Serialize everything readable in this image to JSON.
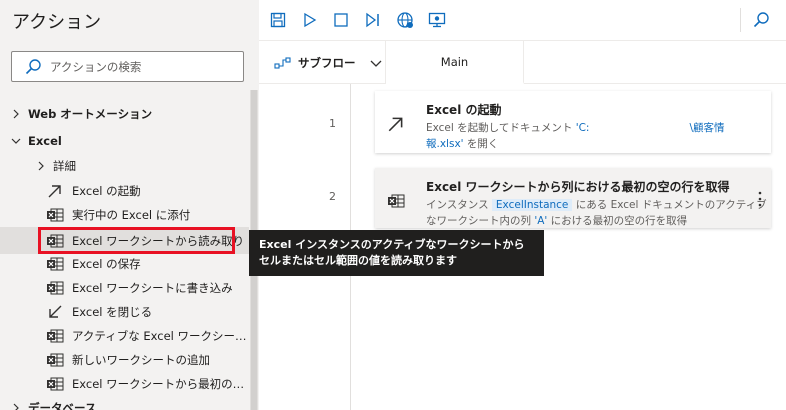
{
  "left_panel": {
    "title": "アクション",
    "search_placeholder": "アクションの検索",
    "groups": [
      {
        "label": "Web オートメーション"
      },
      {
        "label": "Excel"
      },
      {
        "label": "データベース"
      }
    ],
    "excel_subgroup": "詳細",
    "excel_items": [
      {
        "label": "Excel の起動",
        "icon": "arrow-launch-icon"
      },
      {
        "label": "実行中の Excel に添付",
        "icon": "excel-sheet-icon"
      },
      {
        "label": "Excel ワークシートから読み取り",
        "icon": "excel-sheet-icon"
      },
      {
        "label": "Excel の保存",
        "icon": "excel-sheet-icon"
      },
      {
        "label": "Excel ワークシートに書き込み",
        "icon": "excel-sheet-icon"
      },
      {
        "label": "Excel を閉じる",
        "icon": "arrow-close-icon"
      },
      {
        "label": "アクティブな Excel ワークシートの設...",
        "icon": "excel-sheet-icon"
      },
      {
        "label": "新しいワークシートの追加",
        "icon": "excel-sheet-icon"
      },
      {
        "label": "Excel ワークシートから最初の空の...",
        "icon": "excel-sheet-icon"
      }
    ]
  },
  "tooltip": {
    "text": "Excel インスタンスのアクティブなワークシートからセルまたはセル範囲の値を読み取ります"
  },
  "toolbar": {
    "buttons": [
      "save-icon",
      "run-icon",
      "stop-icon",
      "step-icon",
      "web-recorder-icon",
      "desktop-recorder-icon"
    ],
    "search_icon": "search-icon"
  },
  "tabs": {
    "subflow_label": "サブフロー",
    "main_label": "Main"
  },
  "flow": {
    "steps": [
      {
        "number": "1",
        "title": "Excel の起動",
        "desc_prefix": "Excel を起動してドキュメント",
        "desc_path_start": "'C:",
        "desc_path_mid": "\\顧客情",
        "desc_path_end": "報.xlsx'",
        "desc_suffix": " を開く"
      },
      {
        "number": "2",
        "title": "Excel ワークシートから列における最初の空の行を取得",
        "desc_prefix": "インスタンス ",
        "desc_instance": "ExcelInstance",
        "desc_mid": " にある Excel ドキュメントのアクティブ",
        "desc_line2_prefix": "なワークシート内の列 ",
        "desc_column": "'A'",
        "desc_line2_suffix": " における最初の空の行を取得"
      }
    ]
  },
  "colors": {
    "accent": "#0f6cbd",
    "highlight": "#e81123",
    "tooltip_bg": "#201f1e"
  }
}
